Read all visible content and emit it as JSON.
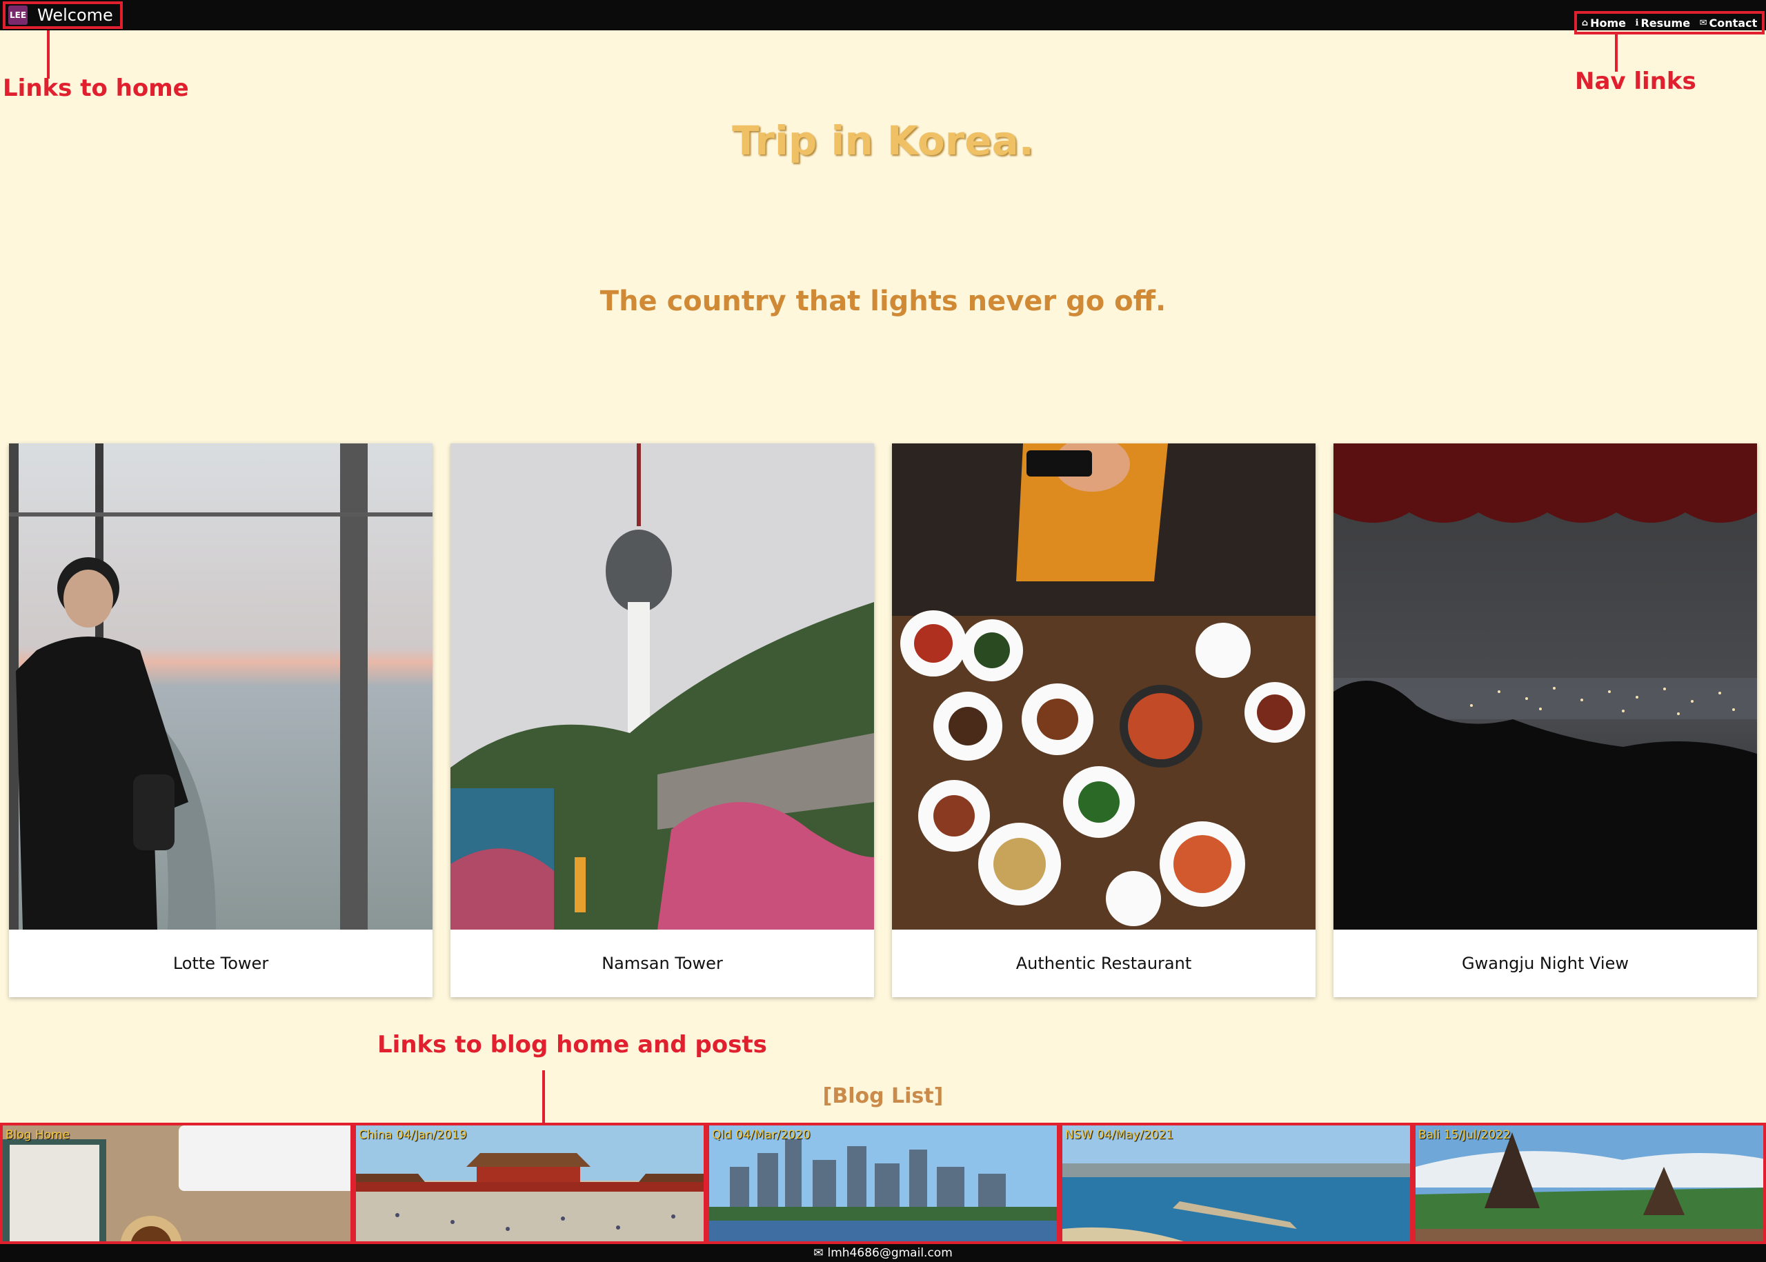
{
  "header": {
    "logo_text": "LEE",
    "brand_title": "Welcome",
    "nav": [
      {
        "icon": "home-icon",
        "label": "Home"
      },
      {
        "icon": "info-icon",
        "label": "Resume"
      },
      {
        "icon": "mail-icon",
        "label": "Contact"
      }
    ]
  },
  "annotations": {
    "home": "Links to home",
    "nav": "Nav links",
    "blog": "Links to blog home and posts"
  },
  "hero": {
    "title": "Trip in Korea.",
    "subtitle": "The country that lights never go off."
  },
  "cards": [
    {
      "label": "Lotte Tower"
    },
    {
      "label": "Namsan Tower"
    },
    {
      "label": "Authentic Restaurant"
    },
    {
      "label": "Gwangju Night View"
    }
  ],
  "blog": {
    "heading": "[Blog List]",
    "tiles": [
      {
        "caption": "Blog Home"
      },
      {
        "caption": "China 04/Jan/2019"
      },
      {
        "caption": "Qld 04/Mar/2020"
      },
      {
        "caption": "NSW 04/May/2021"
      },
      {
        "caption": "Bali 15/Jul/2022"
      }
    ]
  },
  "footer": {
    "icon": "mail-icon",
    "email": "lmh4686@gmail.com"
  },
  "colors": {
    "accent": "#e0202e",
    "background": "#fef7dc",
    "title": "#f0c064",
    "subtitle": "#d08a36"
  }
}
